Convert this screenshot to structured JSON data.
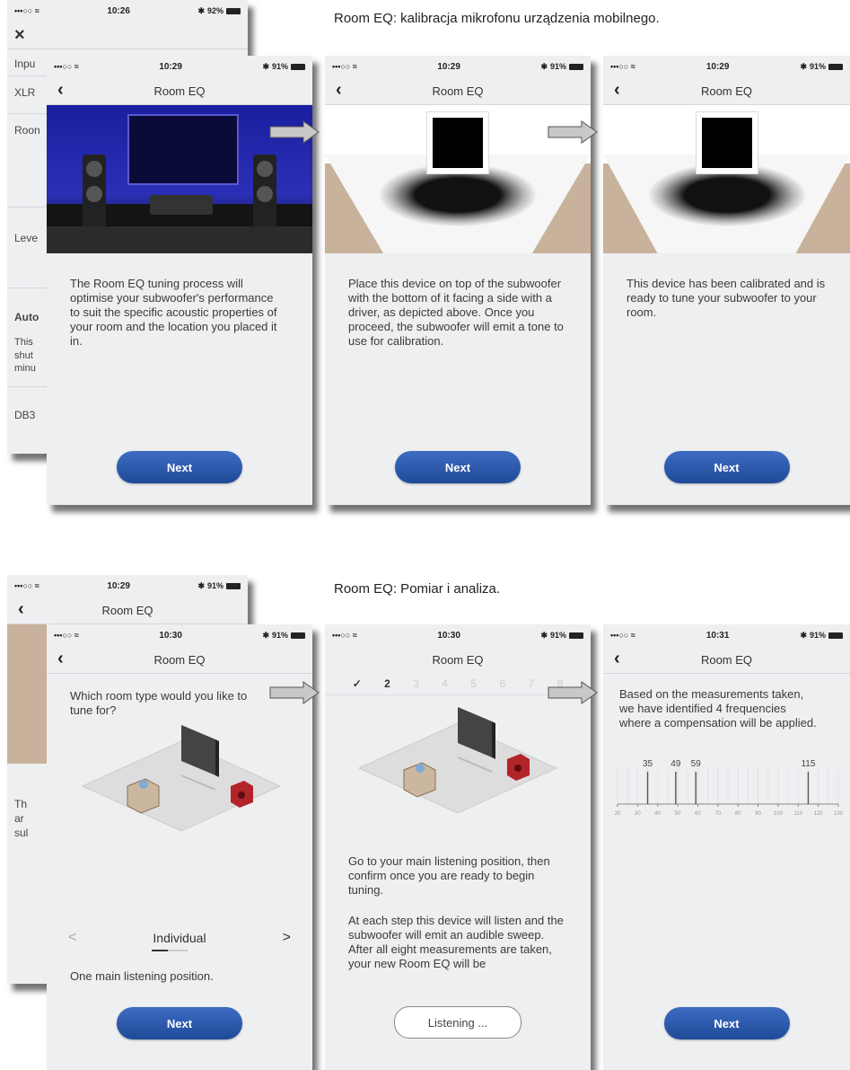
{
  "captions": {
    "top": "Room EQ: kalibracja mikrofonu urządzenia mobilnego.",
    "bottom": "Room EQ: Pomiar i analiza."
  },
  "status": {
    "carrier": "•••○○ ≈",
    "battery_icon": "battery-icon",
    "bluetooth": "✱"
  },
  "times": {
    "t1026": "10:26",
    "t1029": "10:29",
    "t1030": "10:30",
    "t1031": "10:31"
  },
  "battery": {
    "b92": "92%",
    "b91": "91%"
  },
  "nav_title": "Room EQ",
  "back_phone_top": {
    "close": "×",
    "items": [
      "Inpu",
      "XLR",
      "Roon",
      "Leve",
      "Auto",
      "This",
      "shut",
      "minu",
      "DB3"
    ]
  },
  "back_phone_bottom": {
    "lines": [
      "Th",
      "ar",
      "sul"
    ]
  },
  "screen_intro": {
    "text": "The Room EQ tuning process will optimise your subwoofer's performance to suit the specific acoustic properties of your room and the location you placed it in.",
    "next": "Next"
  },
  "screen_place": {
    "text": "Place this device on top of the subwoofer with the bottom of it facing a side with a driver, as depicted above. Once you proceed, the subwoofer will emit a tone to use for calibration.",
    "next": "Next"
  },
  "screen_calibrated": {
    "text": "This device has been calibrated and is ready to tune your subwoofer to your room.",
    "next": "Next"
  },
  "screen_roomtype": {
    "question": "Which room type would you like to tune for?",
    "prev": "<",
    "selected": "Individual",
    "next_arrow": ">",
    "description": "One main listening position.",
    "next": "Next"
  },
  "screen_listen": {
    "steps": [
      "✓",
      "2",
      "3",
      "4",
      "5",
      "6",
      "7",
      "8"
    ],
    "text1": "Go to your main listening position, then confirm once you are ready to begin tuning.",
    "text2": "At each step this device will listen and the subwoofer will emit an audible sweep. After all eight measurements are taken, your new Room EQ will be",
    "button": "Listening ..."
  },
  "screen_results": {
    "text": "Based on the measurements taken, we have identified 4 frequencies where a compensation will be applied.",
    "next": "Next",
    "chart_data": {
      "type": "bar",
      "values": [
        35,
        49,
        59,
        115
      ],
      "data_labels": [
        "35",
        "49",
        "59",
        "115"
      ],
      "xlim": [
        20,
        130
      ],
      "ticks": [
        "20",
        "30",
        "40",
        "50",
        "60",
        "70",
        "80",
        "90",
        "100",
        "110",
        "120",
        "130"
      ]
    }
  },
  "colors": {
    "accent": "#2a58ad",
    "background": "#eeeff1"
  }
}
